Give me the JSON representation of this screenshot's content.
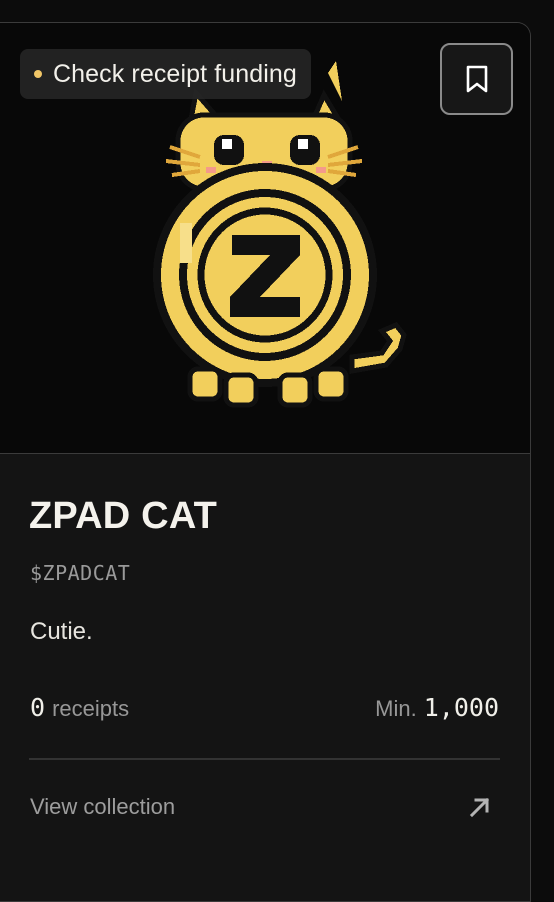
{
  "status": {
    "label": "Check receipt funding",
    "dot_color": "#f0c667"
  },
  "bookmark": {
    "icon": "bookmark-icon"
  },
  "collection": {
    "name": "ZPAD CAT",
    "ticker": "$ZPADCAT",
    "description": "Cutie.",
    "receipts_count": "0",
    "receipts_label": "receipts",
    "min_label": "Min.",
    "min_value": "1,000"
  },
  "footer": {
    "link_label": "View collection",
    "link_icon": "arrow-up-right-icon"
  },
  "colors": {
    "accent_gold": "#f2cf5c",
    "background": "#141414"
  }
}
